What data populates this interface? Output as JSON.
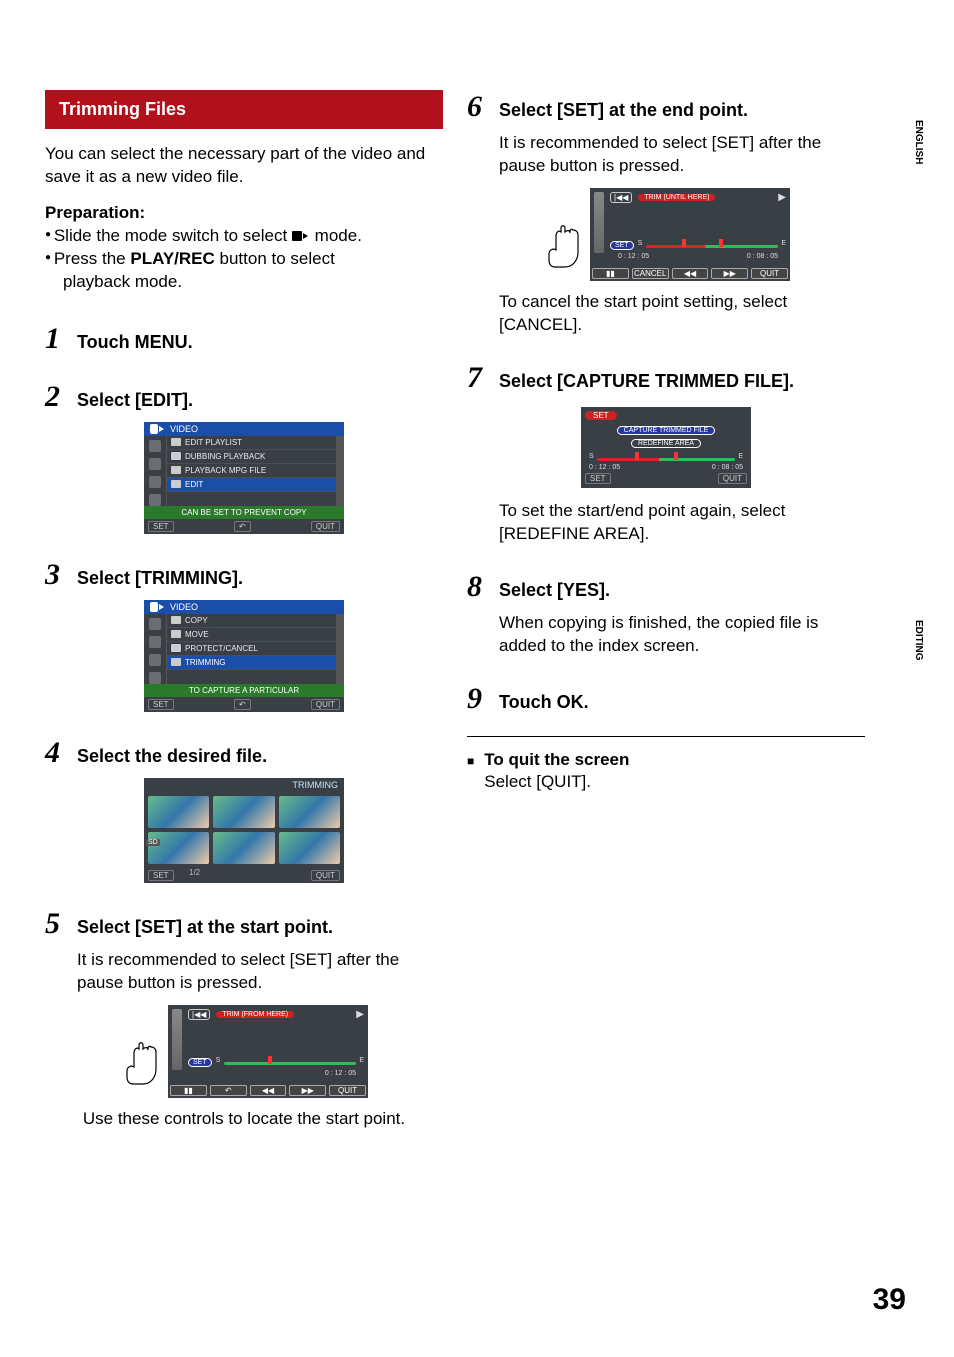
{
  "sideLabels": {
    "top": "ENGLISH",
    "mid": "EDITING"
  },
  "pageNumber": "39",
  "sectionHeader": "Trimming Files",
  "intro": "You can select the necessary part of the video and save it as a new video file.",
  "prep": {
    "heading": "Preparation:",
    "line1a": "Slide the mode switch to select ",
    "line1b": " mode.",
    "line2a": "Press the ",
    "line2bold": "PLAY/REC",
    "line2b": " button to select",
    "line2c": "playback mode."
  },
  "steps": {
    "s1": {
      "num": "1",
      "title": "Touch MENU."
    },
    "s2": {
      "num": "2",
      "title": "Select [EDIT]."
    },
    "s3": {
      "num": "3",
      "title": "Select [TRIMMING]."
    },
    "s4": {
      "num": "4",
      "title": "Select the desired file."
    },
    "s5": {
      "num": "5",
      "title": "Select [SET] at the start point.",
      "body": "It is recommended to select [SET] after the pause button is pressed.",
      "note": "Use these controls to locate the start point."
    },
    "s6": {
      "num": "6",
      "title": "Select [SET] at the end point.",
      "body": "It is recommended to select [SET] after the pause button is pressed.",
      "note": "To cancel the start point setting, select [CANCEL]."
    },
    "s7": {
      "num": "7",
      "title": "Select [CAPTURE TRIMMED FILE].",
      "note": "To set the start/end point again, select [REDEFINE AREA]."
    },
    "s8": {
      "num": "8",
      "title": "Select [YES].",
      "body": "When copying is finished, the copied file is added to the index screen."
    },
    "s9": {
      "num": "9",
      "title": "Touch OK."
    }
  },
  "quit": {
    "heading": "To quit the screen",
    "body": "Select [QUIT]."
  },
  "shot2": {
    "title": "VIDEO",
    "items": [
      "EDIT PLAYLIST",
      "DUBBING PLAYBACK",
      "PLAYBACK MPG FILE",
      "EDIT"
    ],
    "selIndex": 3,
    "hint": "CAN BE SET TO PREVENT COPY",
    "footer": {
      "set": "SET",
      "quit": "QUIT",
      "back": "↶"
    }
  },
  "shot3": {
    "title": "VIDEO",
    "items": [
      "COPY",
      "MOVE",
      "PROTECT/CANCEL",
      "TRIMMING"
    ],
    "selIndex": 3,
    "hint": "TO CAPTURE A PARTICULAR",
    "footer": {
      "set": "SET",
      "quit": "QUIT",
      "back": "↶"
    }
  },
  "shot4": {
    "title": "TRIMMING",
    "page": "1/2",
    "sd": "SD",
    "footer": {
      "set": "SET",
      "quit": "QUIT"
    }
  },
  "shot5": {
    "skip": "|◀◀",
    "red": "TRIM (FROM HERE)",
    "play": "▶",
    "set": "SET",
    "S": "S",
    "E": "E",
    "time": "0 : 12 : 05",
    "ctrl": [
      "▮▮",
      "↶",
      "◀◀",
      "▶▶",
      "QUIT"
    ]
  },
  "shot6": {
    "skip": "|◀◀",
    "red": "TRIM (UNTIL HERE)",
    "play": "▶",
    "set": "SET",
    "S": "S",
    "E": "E",
    "timeL": "0 : 12 : 05",
    "timeR": "0 : 08 : 05",
    "ctrl": [
      "▮▮",
      "CANCEL",
      "◀◀",
      "▶▶",
      "QUIT"
    ]
  },
  "shot7": {
    "set": "SET",
    "opt1": "CAPTURE TRIMMED FILE",
    "opt2": "REDEFINE AREA",
    "S": "S",
    "E": "E",
    "timeL": "0 : 12 : 05",
    "timeR": "0 : 08 : 05",
    "footSet": "SET",
    "footQuit": "QUIT"
  }
}
